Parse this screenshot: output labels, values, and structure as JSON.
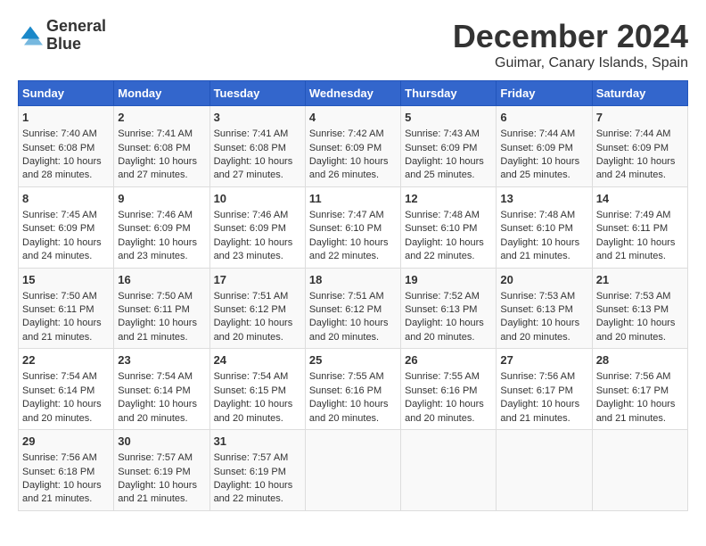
{
  "header": {
    "logo_line1": "General",
    "logo_line2": "Blue",
    "title": "December 2024",
    "subtitle": "Guimar, Canary Islands, Spain"
  },
  "days_of_week": [
    "Sunday",
    "Monday",
    "Tuesday",
    "Wednesday",
    "Thursday",
    "Friday",
    "Saturday"
  ],
  "weeks": [
    [
      {
        "day": "1",
        "info": "Sunrise: 7:40 AM\nSunset: 6:08 PM\nDaylight: 10 hours\nand 28 minutes."
      },
      {
        "day": "2",
        "info": "Sunrise: 7:41 AM\nSunset: 6:08 PM\nDaylight: 10 hours\nand 27 minutes."
      },
      {
        "day": "3",
        "info": "Sunrise: 7:41 AM\nSunset: 6:08 PM\nDaylight: 10 hours\nand 27 minutes."
      },
      {
        "day": "4",
        "info": "Sunrise: 7:42 AM\nSunset: 6:09 PM\nDaylight: 10 hours\nand 26 minutes."
      },
      {
        "day": "5",
        "info": "Sunrise: 7:43 AM\nSunset: 6:09 PM\nDaylight: 10 hours\nand 25 minutes."
      },
      {
        "day": "6",
        "info": "Sunrise: 7:44 AM\nSunset: 6:09 PM\nDaylight: 10 hours\nand 25 minutes."
      },
      {
        "day": "7",
        "info": "Sunrise: 7:44 AM\nSunset: 6:09 PM\nDaylight: 10 hours\nand 24 minutes."
      }
    ],
    [
      {
        "day": "8",
        "info": "Sunrise: 7:45 AM\nSunset: 6:09 PM\nDaylight: 10 hours\nand 24 minutes."
      },
      {
        "day": "9",
        "info": "Sunrise: 7:46 AM\nSunset: 6:09 PM\nDaylight: 10 hours\nand 23 minutes."
      },
      {
        "day": "10",
        "info": "Sunrise: 7:46 AM\nSunset: 6:09 PM\nDaylight: 10 hours\nand 23 minutes."
      },
      {
        "day": "11",
        "info": "Sunrise: 7:47 AM\nSunset: 6:10 PM\nDaylight: 10 hours\nand 22 minutes."
      },
      {
        "day": "12",
        "info": "Sunrise: 7:48 AM\nSunset: 6:10 PM\nDaylight: 10 hours\nand 22 minutes."
      },
      {
        "day": "13",
        "info": "Sunrise: 7:48 AM\nSunset: 6:10 PM\nDaylight: 10 hours\nand 21 minutes."
      },
      {
        "day": "14",
        "info": "Sunrise: 7:49 AM\nSunset: 6:11 PM\nDaylight: 10 hours\nand 21 minutes."
      }
    ],
    [
      {
        "day": "15",
        "info": "Sunrise: 7:50 AM\nSunset: 6:11 PM\nDaylight: 10 hours\nand 21 minutes."
      },
      {
        "day": "16",
        "info": "Sunrise: 7:50 AM\nSunset: 6:11 PM\nDaylight: 10 hours\nand 21 minutes."
      },
      {
        "day": "17",
        "info": "Sunrise: 7:51 AM\nSunset: 6:12 PM\nDaylight: 10 hours\nand 20 minutes."
      },
      {
        "day": "18",
        "info": "Sunrise: 7:51 AM\nSunset: 6:12 PM\nDaylight: 10 hours\nand 20 minutes."
      },
      {
        "day": "19",
        "info": "Sunrise: 7:52 AM\nSunset: 6:13 PM\nDaylight: 10 hours\nand 20 minutes."
      },
      {
        "day": "20",
        "info": "Sunrise: 7:53 AM\nSunset: 6:13 PM\nDaylight: 10 hours\nand 20 minutes."
      },
      {
        "day": "21",
        "info": "Sunrise: 7:53 AM\nSunset: 6:13 PM\nDaylight: 10 hours\nand 20 minutes."
      }
    ],
    [
      {
        "day": "22",
        "info": "Sunrise: 7:54 AM\nSunset: 6:14 PM\nDaylight: 10 hours\nand 20 minutes."
      },
      {
        "day": "23",
        "info": "Sunrise: 7:54 AM\nSunset: 6:14 PM\nDaylight: 10 hours\nand 20 minutes."
      },
      {
        "day": "24",
        "info": "Sunrise: 7:54 AM\nSunset: 6:15 PM\nDaylight: 10 hours\nand 20 minutes."
      },
      {
        "day": "25",
        "info": "Sunrise: 7:55 AM\nSunset: 6:16 PM\nDaylight: 10 hours\nand 20 minutes."
      },
      {
        "day": "26",
        "info": "Sunrise: 7:55 AM\nSunset: 6:16 PM\nDaylight: 10 hours\nand 20 minutes."
      },
      {
        "day": "27",
        "info": "Sunrise: 7:56 AM\nSunset: 6:17 PM\nDaylight: 10 hours\nand 21 minutes."
      },
      {
        "day": "28",
        "info": "Sunrise: 7:56 AM\nSunset: 6:17 PM\nDaylight: 10 hours\nand 21 minutes."
      }
    ],
    [
      {
        "day": "29",
        "info": "Sunrise: 7:56 AM\nSunset: 6:18 PM\nDaylight: 10 hours\nand 21 minutes."
      },
      {
        "day": "30",
        "info": "Sunrise: 7:57 AM\nSunset: 6:19 PM\nDaylight: 10 hours\nand 21 minutes."
      },
      {
        "day": "31",
        "info": "Sunrise: 7:57 AM\nSunset: 6:19 PM\nDaylight: 10 hours\nand 22 minutes."
      },
      {
        "day": "",
        "info": ""
      },
      {
        "day": "",
        "info": ""
      },
      {
        "day": "",
        "info": ""
      },
      {
        "day": "",
        "info": ""
      }
    ]
  ]
}
